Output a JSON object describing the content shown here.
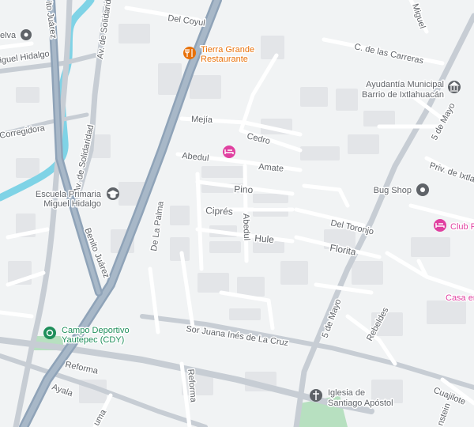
{
  "map": {
    "colors": {
      "background": "#f1f3f4",
      "block": "#e3e5e8",
      "road_minor": "#ffffff",
      "road_secondary": "#c7cdd4",
      "highway": "#8fa3b8",
      "river": "#7fd3e6",
      "park": "#b7e0c0",
      "label": "#5f6368",
      "food": "#e8710a",
      "shop": "#1a73e8",
      "gov": "#5f6368",
      "hotel": "#e040a0",
      "sport": "#1e8e5a",
      "church": "#5f6368"
    },
    "streets": {
      "del_coyul": "Del Coyul",
      "miguel_top": "Miguel",
      "c_carreras": "C. de las Carreras",
      "av_solidaridad_top": "Av. de Solidaridad",
      "av_solidaridad_mid": "Av. de Solidaridad",
      "benito_juarez_top": "ito Juárez",
      "benito_juarez_bottom": "Benito Juárez",
      "miguel_hidalgo_left": "iguel Hidalgo",
      "corregidora": "Corregidora",
      "mejia": "Mejía",
      "cedro": "Cedro",
      "abedul_top": "Abedul",
      "amate": "Amate",
      "pino": "Pino",
      "cipres": "Ciprés",
      "abedul_vertical": "Abedul",
      "hule": "Hule",
      "de_la_palma": "De La Palma",
      "del_toronjo": "Del Toronjo",
      "florita": "Florita",
      "cinco_de_mayo_top": "5 de Mayo",
      "cinco_de_mayo_bottom": "5 de Mayo",
      "priv_ixtlahuacan": "Priv. de Ixtlah",
      "rebeldes": "Rebeldes",
      "cuajilote": "Cuajilote",
      "sor_juana": "Sor Juana Inés de La Cruz",
      "reforma_left": "Reforma",
      "reforma_vertical": "Reforma",
      "ayala": "Ayala",
      "hidalgo_edge": "idalgo",
      "uma_edge": "uma",
      "nstein_edge": "nstein",
      "selva": "elva"
    },
    "pois": {
      "tierra_grande_line1": "Tierra Grande",
      "tierra_grande_line2": "Restaurante",
      "ayudantia_line1": "Ayudantía Municipal",
      "ayudantia_line2": "Barrio de Ixtlahuacán",
      "bug_shop": "Bug Shop",
      "club": "Club R",
      "casa": "Casa en",
      "escuela_line1": "Escuela Primaria",
      "escuela_line2": "Miguel Hidalgo",
      "campo_line1": "Campo Deportivo",
      "campo_line2": "Yautepec (CDY)",
      "iglesia_line1": "Iglesia de",
      "iglesia_line2": "Santiago Apóstol"
    },
    "icons": {
      "restaurant": "fork-knife",
      "government": "building-columns",
      "shop": "store",
      "hotel": "bed",
      "school": "graduation-cap",
      "sport": "stadium",
      "church": "cross"
    }
  }
}
